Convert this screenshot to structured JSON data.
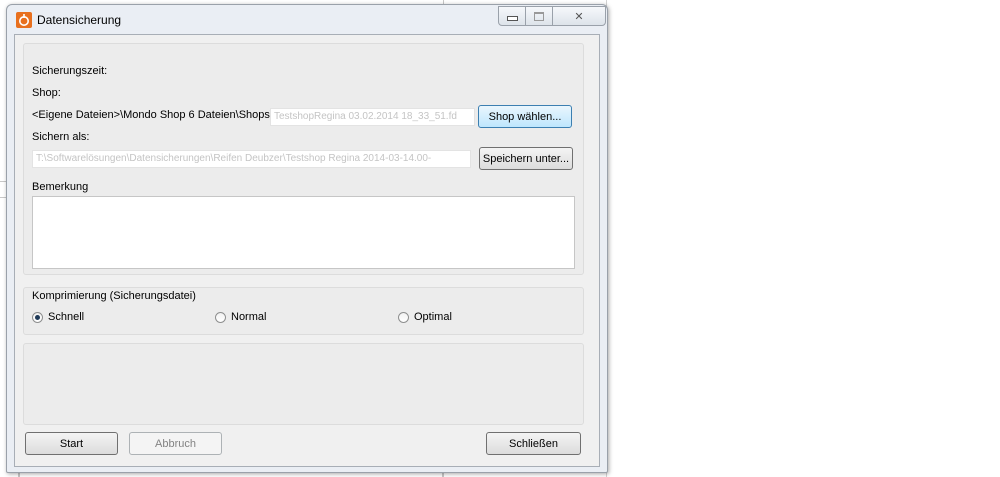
{
  "window": {
    "title": "Datensicherung",
    "minimize_icon": "minimize-icon",
    "maximize_icon": "maximize-icon",
    "close_icon": "close-icon",
    "close_glyph": "✕"
  },
  "backup": {
    "time_label": "Sicherungszeit:",
    "shop_label": "Shop:",
    "shop_path_prefix": "<Eigene Dateien>\\Mondo Shop 6 Dateien\\Shops\\",
    "shop_path_name": "TestshopRegina 03.02.2014 18_33_51.fd",
    "shop_button": "Shop wählen...",
    "save_as_label": "Sichern als:",
    "save_as_value": "T:\\Softwarelösungen\\Datensicherungen\\Reifen Deubzer\\Testshop Regina 2014-03-14.00-",
    "save_button": "Speichern unter...",
    "remark_label": "Bemerkung",
    "remark_value": ""
  },
  "compression": {
    "label": "Komprimierung (Sicherungsdatei)",
    "options": [
      {
        "label": "Schnell",
        "selected": true
      },
      {
        "label": "Normal",
        "selected": false
      },
      {
        "label": "Optimal",
        "selected": false
      }
    ]
  },
  "footer": {
    "start_button": "Start",
    "abort_button": "Abbruch",
    "close_button": "Schließen"
  }
}
